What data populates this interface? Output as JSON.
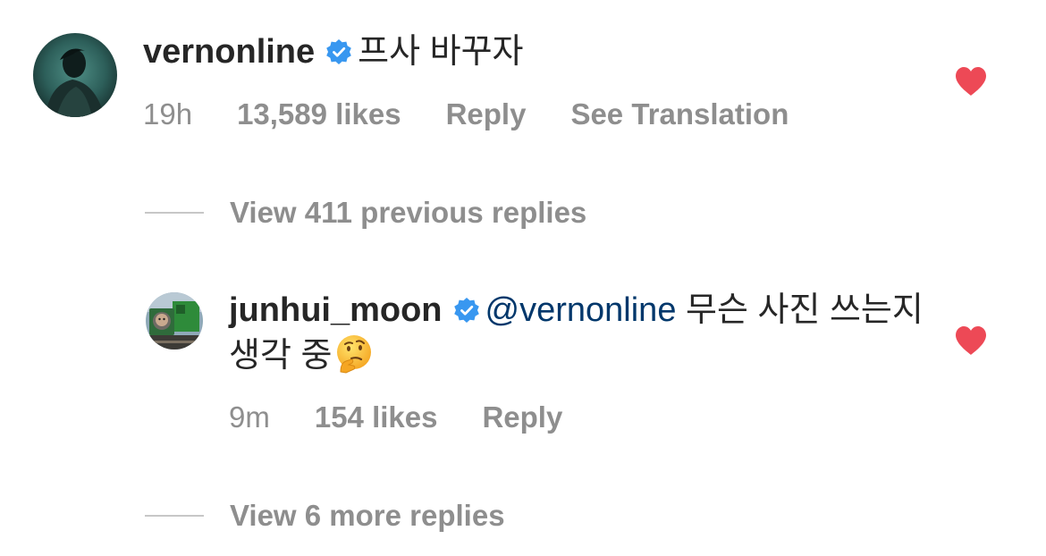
{
  "colors": {
    "text": "#262626",
    "meta": "#8e8e8e",
    "mention": "#00376b",
    "verified": "#3897f0",
    "heart": "#ed4956",
    "thread_line": "#c7c7c7"
  },
  "comment": {
    "username": "vernonline",
    "verified_icon": "verified-badge-icon",
    "text": "프사 바꾸자",
    "time": "19h",
    "likes": "13,589 likes",
    "reply_label": "Reply",
    "translate_label": "See Translation",
    "liked": true,
    "like_icon": "heart-filled-icon"
  },
  "view_previous": {
    "label": "View 411 previous replies"
  },
  "reply": {
    "username": "junhui_moon",
    "verified_icon": "verified-badge-icon",
    "mention": "@vernonline",
    "text": " 무슨 사진 쓰는지 생각 중",
    "emoji": "thinking-face-icon",
    "time": "9m",
    "likes": "154 likes",
    "reply_label": "Reply",
    "liked": true,
    "like_icon": "heart-filled-icon"
  },
  "view_more": {
    "label": "View 6 more replies"
  }
}
